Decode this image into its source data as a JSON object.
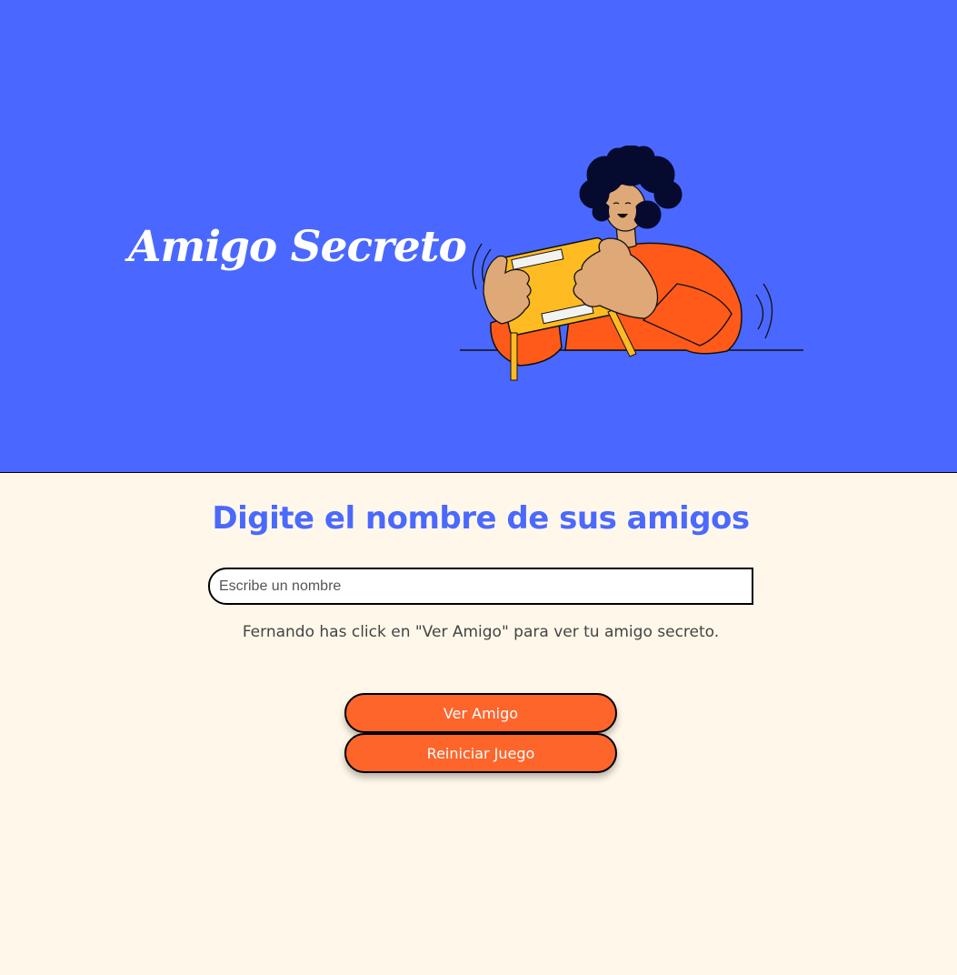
{
  "header": {
    "title": "Amigo Secreto",
    "illustration": "person-playing-handheld-console",
    "background_color": "#4A68FF"
  },
  "main": {
    "heading": "Digite el nombre de sus amigos",
    "heading_color": "#4B69FD",
    "background_color": "#FFF8EA",
    "name_input": {
      "placeholder": "Escribe un nombre",
      "value": ""
    },
    "result_message": "Fernando has click en \"Ver Amigo\" para ver tu amigo secreto.",
    "buttons": {
      "ver_amigo": "Ver Amigo",
      "reiniciar": "Reiniciar Juego"
    },
    "button_color": "#FE652B"
  }
}
